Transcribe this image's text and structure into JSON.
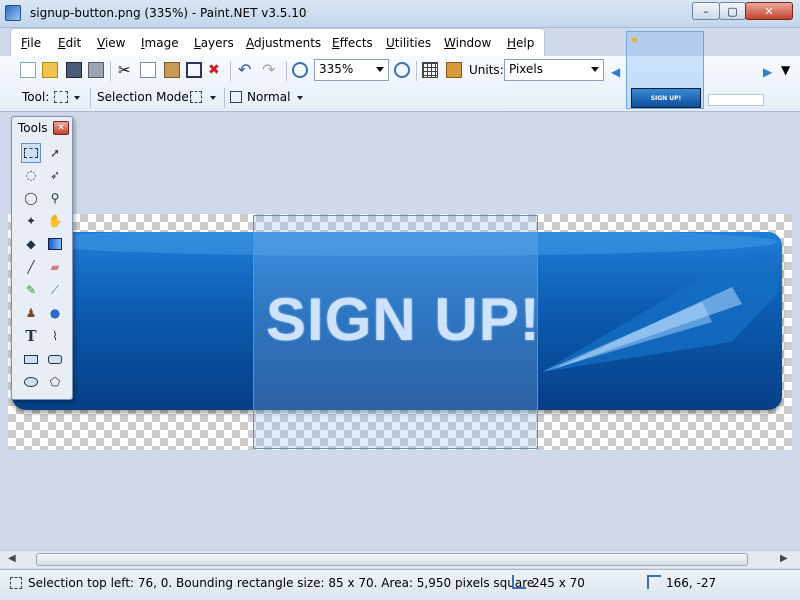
{
  "window": {
    "title": "signup-button.png (335%) - Paint.NET v3.5.10",
    "min_label": "–",
    "max_label": "▢",
    "close_label": "✕"
  },
  "menu": [
    "File",
    "Edit",
    "View",
    "Image",
    "Layers",
    "Adjustments",
    "Effects",
    "Utilities",
    "Window",
    "Help"
  ],
  "toolbar": {
    "zoom_value": "335%",
    "units_label": "Units:",
    "units_value": "Pixels",
    "tool_label": "Tool:",
    "selection_mode_label": "Selection Mode:",
    "blend_mode": "Normal"
  },
  "thumbnail": {
    "text": "SIGN UP!"
  },
  "tools_panel": {
    "title": "Tools",
    "close": "✕"
  },
  "canvas": {
    "button_text": "SIGN UP!"
  },
  "status": {
    "selection_info": "Selection top left: 76, 0. Bounding rectangle size: 85 x 70. Area: 5,950 pixels square",
    "image_size": "245 x 70",
    "cursor_pos": "166, -27"
  },
  "colors": {
    "titlebar": "#c3d6ec",
    "accent": "#1f7fd8",
    "button_dark": "#063f86",
    "workspace": "#cfd9ea"
  }
}
